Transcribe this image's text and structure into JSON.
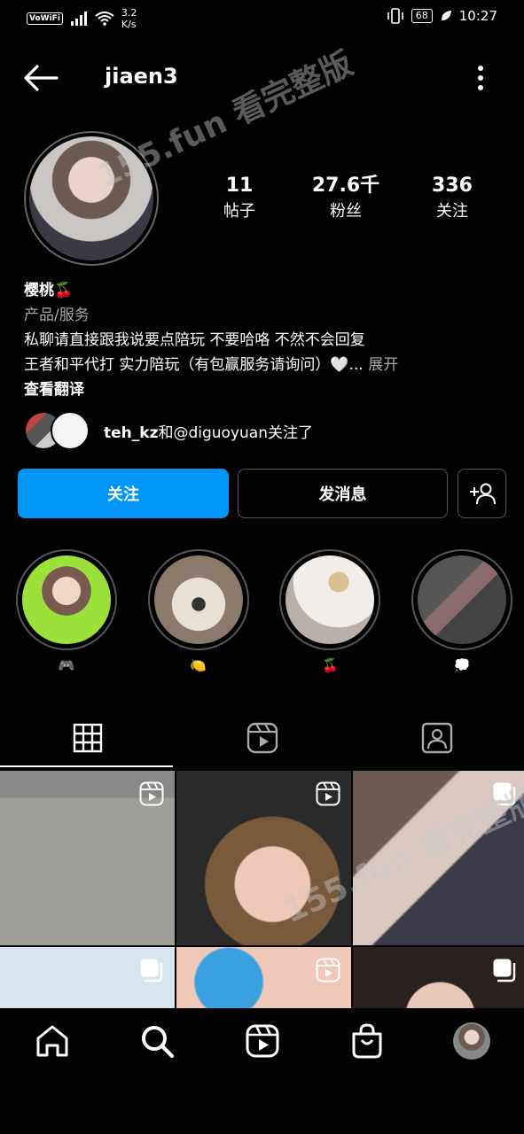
{
  "status_bar": {
    "vowifi": "VoWiFi",
    "speed_value": "3.2",
    "speed_unit": "K/s",
    "battery": "68",
    "time": "10:27"
  },
  "header": {
    "username": "jiaen3",
    "back_icon": "arrow-left-icon",
    "more_icon": "kebab-menu-icon"
  },
  "profile": {
    "stats": [
      {
        "num": "11",
        "label": "帖子"
      },
      {
        "num": "27.6千",
        "label": "粉丝"
      },
      {
        "num": "336",
        "label": "关注"
      }
    ],
    "name": "樱桃🍒",
    "category": "产品/服务",
    "bio_line1": "私聊请直接跟我说要点陪玩 不要哈咯 不然不会回复",
    "bio_line2": "王者和平代打 实力陪玩（有包赢服务请询问）🤍...",
    "bio_more": "展开",
    "translate": "查看翻译",
    "followed_by_user": "teh_kz",
    "followed_by_rest": "和@diguoyuan关注了"
  },
  "watermark": "155.fun 看完整版",
  "buttons": {
    "follow": "关注",
    "message": "发消息",
    "add_user_icon": "add-person-icon"
  },
  "highlights": [
    {
      "label": "🎮"
    },
    {
      "label": "🍋"
    },
    {
      "label": "🍒"
    },
    {
      "label": "💭"
    }
  ],
  "tabs": [
    {
      "icon": "grid-icon",
      "active": true
    },
    {
      "icon": "reels-icon",
      "active": false
    },
    {
      "icon": "tagged-icon",
      "active": false
    }
  ],
  "grid_badges": [
    "reels-icon",
    "reels-icon",
    "carousel-icon",
    "carousel-icon",
    "reels-icon",
    "carousel-icon"
  ],
  "bottom_nav": [
    "home-icon",
    "search-icon",
    "reels-icon",
    "shop-icon",
    "profile-avatar"
  ],
  "colors": {
    "accent": "#0095f6",
    "background": "#000000"
  }
}
